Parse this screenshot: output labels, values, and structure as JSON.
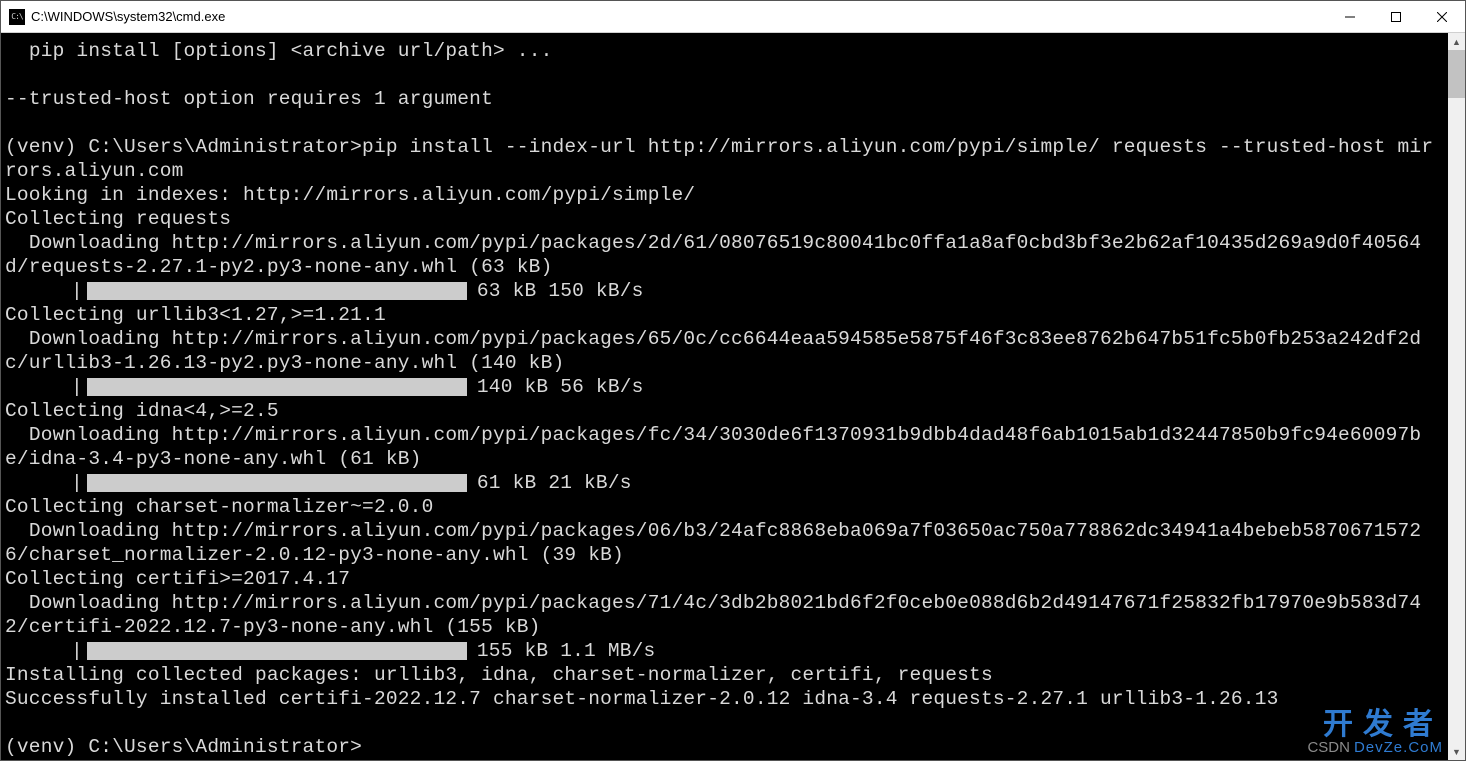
{
  "window": {
    "title": "C:\\WINDOWS\\system32\\cmd.exe",
    "icon_label": "C:\\"
  },
  "console": {
    "lines": [
      "  pip install [options] <archive url/path> ...",
      "",
      "--trusted-host option requires 1 argument",
      "",
      "(venv) C:\\Users\\Administrator>pip install --index-url http://mirrors.aliyun.com/pypi/simple/ requests --trusted-host mirrors.aliyun.com",
      "Looking in indexes: http://mirrors.aliyun.com/pypi/simple/",
      "Collecting requests",
      "  Downloading http://mirrors.aliyun.com/pypi/packages/2d/61/08076519c80041bc0ffa1a8af0cbd3bf3e2b62af10435d269a9d0f40564d/requests-2.27.1-py2.py3-none-any.whl (63 kB)",
      "Collecting urllib3<1.27,>=1.21.1",
      "  Downloading http://mirrors.aliyun.com/pypi/packages/65/0c/cc6644eaa594585e5875f46f3c83ee8762b647b51fc5b0fb253a242df2dc/urllib3-1.26.13-py2.py3-none-any.whl (140 kB)",
      "Collecting idna<4,>=2.5",
      "  Downloading http://mirrors.aliyun.com/pypi/packages/fc/34/3030de6f1370931b9dbb4dad48f6ab1015ab1d32447850b9fc94e60097be/idna-3.4-py3-none-any.whl (61 kB)",
      "Collecting charset-normalizer~=2.0.0",
      "  Downloading http://mirrors.aliyun.com/pypi/packages/06/b3/24afc8868eba069a7f03650ac750a778862dc34941a4bebeb58706715726/charset_normalizer-2.0.12-py3-none-any.whl (39 kB)",
      "Collecting certifi>=2017.4.17",
      "  Downloading http://mirrors.aliyun.com/pypi/packages/71/4c/3db2b8021bd6f2f0ceb0e088d6b2d49147671f25832fb17970e9b583d742/certifi-2022.12.7-py3-none-any.whl (155 kB)",
      "Installing collected packages: urllib3, idna, charset-normalizer, certifi, requests",
      "Successfully installed certifi-2022.12.7 charset-normalizer-2.0.12 idna-3.4 requests-2.27.1 urllib3-1.26.13",
      "",
      "(venv) C:\\Users\\Administrator>"
    ],
    "progress_bars": [
      {
        "after_line": 7,
        "text": "63 kB 150 kB/s"
      },
      {
        "after_line": 9,
        "text": "140 kB 56 kB/s"
      },
      {
        "after_line": 11,
        "text": "61 kB 21 kB/s"
      },
      {
        "after_line": 15,
        "text": "155 kB 1.1 MB/s"
      }
    ]
  },
  "watermark": {
    "line1": "开发者",
    "csdn": "CSDN",
    "line2": "DevZe.CoM"
  }
}
